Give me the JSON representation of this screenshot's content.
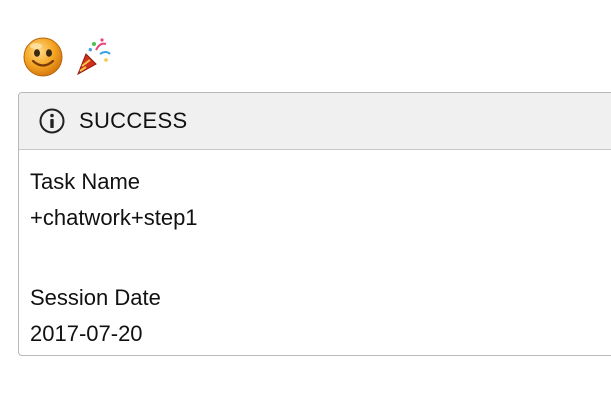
{
  "emojis": {
    "smile": "smiley-face-icon",
    "party": "party-popper-icon"
  },
  "status_panel": {
    "title": "SUCCESS",
    "icon": "info-circle-icon",
    "fields": [
      {
        "label": "Task Name",
        "value": "+chatwork+step1"
      },
      {
        "label": "Session Date",
        "value": "2017-07-20"
      }
    ]
  },
  "colors": {
    "header_bg": "#f0f0f0",
    "border": "#b8b8b8",
    "text": "#111111"
  }
}
